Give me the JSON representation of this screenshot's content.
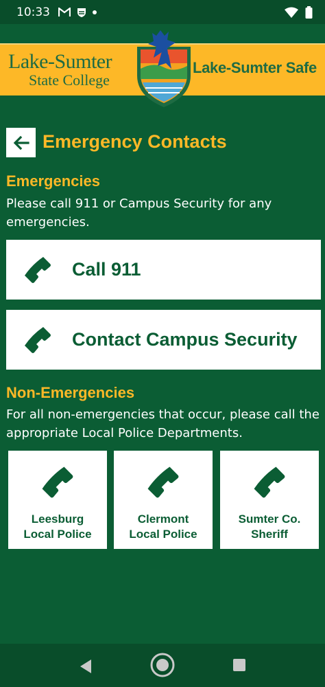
{
  "status_bar": {
    "time": "10:33",
    "icons": [
      "gmail-icon",
      "shield-app-icon",
      "dot-icon",
      "wifi-icon",
      "battery-icon"
    ]
  },
  "banner": {
    "college_line1": "Lake-Sumter",
    "college_line2": "State College",
    "app_name": "Lake-Sumter Safe",
    "colors": {
      "gold": "#fdb827",
      "green": "#1e6b43"
    }
  },
  "header": {
    "title": "Emergency Contacts",
    "back_icon": "arrow-left-icon"
  },
  "emergencies": {
    "heading": "Emergencies",
    "text": "Please call 911 or Campus Security for any emergencies.",
    "buttons": [
      {
        "label": "Call 911",
        "icon": "phone-icon"
      },
      {
        "label": "Contact Campus Security",
        "icon": "phone-icon"
      }
    ]
  },
  "non_emergencies": {
    "heading": "Non-Emergencies",
    "text": "For all non-emergencies that occur, please call the appropriate Local Police Departments.",
    "cards": [
      {
        "line1": "Leesburg",
        "line2": "Local Police",
        "icon": "phone-icon"
      },
      {
        "line1": "Clermont",
        "line2": "Local Police",
        "icon": "phone-icon"
      },
      {
        "line1": "Sumter Co.",
        "line2": "Sheriff",
        "icon": "phone-icon"
      }
    ]
  },
  "nav_bar": {
    "icons": [
      "nav-back-icon",
      "nav-home-icon",
      "nav-recents-icon"
    ]
  },
  "theme": {
    "background": "#0b5d34",
    "accent": "#fdb827",
    "card": "#ffffff"
  }
}
